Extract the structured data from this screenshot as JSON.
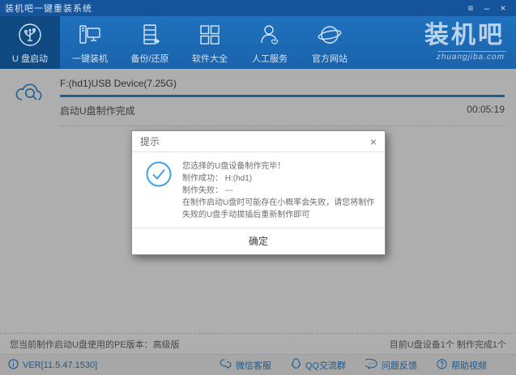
{
  "titlebar": {
    "title": "装机吧一键重装系统",
    "menu_icon": "≡",
    "minimize_icon": "–",
    "close_icon": "×"
  },
  "nav": {
    "items": [
      {
        "label": "U 盘启动",
        "icon": "usb-icon",
        "active": true
      },
      {
        "label": "一键装机",
        "icon": "computer-icon",
        "active": false
      },
      {
        "label": "备份/还原",
        "icon": "backup-restore-icon",
        "active": false
      },
      {
        "label": "软件大全",
        "icon": "software-grid-icon",
        "active": false
      },
      {
        "label": "人工服务",
        "icon": "support-person-icon",
        "active": false
      },
      {
        "label": "官方网站",
        "icon": "website-globe-icon",
        "active": false
      }
    ],
    "logo": "装机吧",
    "logo_domain": "zhuangjiba.com"
  },
  "task": {
    "device": "F:(hd1)USB Device(7.25G)",
    "status": "启动U盘制作完成",
    "elapsed": "00:05:19",
    "progress_percent": 100
  },
  "dialog": {
    "title": "提示",
    "close_icon": "×",
    "line1": "您选择的U盘设备制作完毕！",
    "line2": "制作成功： H:(hd1)",
    "line3": "制作失败： ---",
    "line4": "在制作启动U盘时可能存在小概率会失败，请您将制作失败的U盘手动拔插后重新制作即可",
    "ok_label": "确定"
  },
  "statusbar": {
    "left": "您当前制作启动U盘使用的PE版本：高级版",
    "right": "目前U盘设备1个 制作完成1个"
  },
  "bottombar": {
    "version": "VER[11.5.47.1530]",
    "links": [
      {
        "label": "微信客服",
        "icon": "wechat-icon"
      },
      {
        "label": "QQ交流群",
        "icon": "qq-icon"
      },
      {
        "label": "问题反馈",
        "icon": "feedback-bubble-icon"
      },
      {
        "label": "帮助视频",
        "icon": "help-video-icon"
      }
    ]
  },
  "colors": {
    "accent_blue": "#2b87cf",
    "nav_blue": "#1d6ab4",
    "titlebar_blue": "#15539b",
    "active_tab_blue": "#0f4a82",
    "link_blue": "#2d7dc0"
  }
}
